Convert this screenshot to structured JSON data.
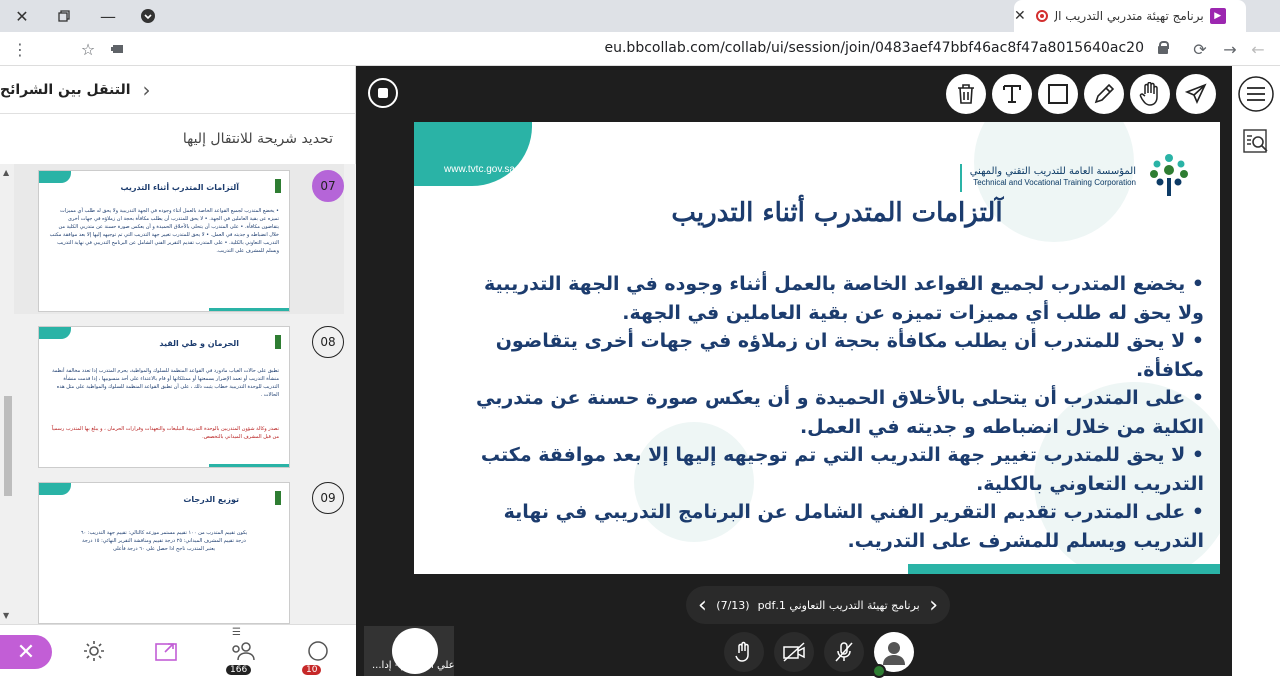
{
  "browser": {
    "tab_title": "برنامج تهيئة متدربي التدريب ال",
    "url": "eu.bbcollab.com/collab/ui/session/join/0483aef47bbf46ac8f47a8015640ac20"
  },
  "left_panel": {
    "header_title": "التنقل بين الشرائح",
    "subtitle": "تحديد شريحة للانتقال إليها",
    "slides": [
      {
        "number": "07",
        "title": "آلتزامات المتدرب أثناء التدريب",
        "body": "• يخضع المتدرب لجميع القواعد الخاصة بالعمل أثناء وجوده في الجهة التدريبية ولا يحق له طلب أي مميزات تميزه عن بقية العاملين في الجهة. • لا يحق للمتدرب أن يطلب مكافأة بحجة ان زملاؤه في جهات أخرى يتقاضون مكافأة. • على المتدرب أن يتحلى بالأخلاق الحميدة و أن يعكس صورة حسنة عن متدربي الكلية من خلال انضباطه و جديته في العمل. • لا يحق للمتدرب تغيير جهة التدريب التي تم توجيهه إليها إلا بعد موافقة مكتب التدريب التعاوني بالكلية. • على المتدرب تقديم التقرير الفني الشامل عن البرنامج التدريبي في نهاية التدريب ويسلم للمشرف على التدريب."
      },
      {
        "number": "08",
        "title": "الحرمان و طي القيد",
        "body": "تطبق على حالات الغياب مادورد في القواعد المنظمة للسلوك والمواظبة، يحرم المتدرب إذا تعدد مخالفة أنظمة منشأة التدريب أو تعمد الإضرار بسمعتها أو ممتلكاتها أو قام بالاعتداء على أحد منسوبيها ، إذا قدمت منشأة التدريب للوحدة التدريبية خطاب يثبت ذلك ، على أن تطبق القواعد المنظمة للسلوك والمواظبة على مثل هذه الحالات .",
        "note": "تصدر وكالة شؤون المتدربين بالوحدة التدريبية التبليغات والتعهدات وقرارات الحرمان ، و يبلغ بها المتدرب رسمياً من قبل المشرف الميداني بالتخصص."
      },
      {
        "number": "09",
        "title": "توزيع الدرجات",
        "body": "يكون تقييم المتدرب من ١٠٠ تقييم مستمر موزعه كالتالي: تقييم جهة التدريب: ٦٠ درجة تقييم المشرف الميداني: ٢٥ درجة تقييم ومناقشة التقرير النهائي: ١٥ درجة يعتبر المتدرب ناجح اذا حصل على ٦٠ درجة فأعلى"
      }
    ],
    "bottom": {
      "participants_count": "166",
      "chat_count": "10"
    }
  },
  "stage": {
    "slide": {
      "website": "www.tvtc.gov.sa",
      "org_ar": "المؤسسة العامة للتدريب التقني والمهني",
      "org_en": "Technical and Vocational Training Corporation",
      "title": "آلتزامات المتدرب أثناء التدريب",
      "bullets": [
        "يخضع المتدرب لجميع القواعد الخاصة بالعمل أثناء وجوده في الجهة التدريبية ولا يحق له طلب أي مميزات تميزه عن بقية العاملين في الجهة.",
        "لا يحق للمتدرب أن يطلب مكافأة بحجة ان زملاؤه في جهات أخرى يتقاضون مكافأة.",
        "على المتدرب أن يتحلى بالأخلاق الحميدة و أن يعكس صورة حسنة عن متدربي الكلية من خلال انضباطه و جديته في العمل.",
        "لا يحق للمتدرب تغيير جهة التدريب التي تم توجيهه إليها إلا بعد موافقة مكتب التدريب التعاوني بالكلية.",
        "على المتدرب تقديم التقرير الفني الشامل عن البرنامج التدريبي في نهاية التدريب ويسلم للمشرف على التدريب."
      ]
    },
    "nav": {
      "counter": "(7/13)",
      "file": "برنامج تهيئة التدريب التعاوني 1.pdf"
    },
    "self_name": "علي ال صقر - إدا..."
  },
  "colors": {
    "teal": "#2ab3a6",
    "navy": "#1c3c6e",
    "accent_purple": "#c25ed6"
  }
}
